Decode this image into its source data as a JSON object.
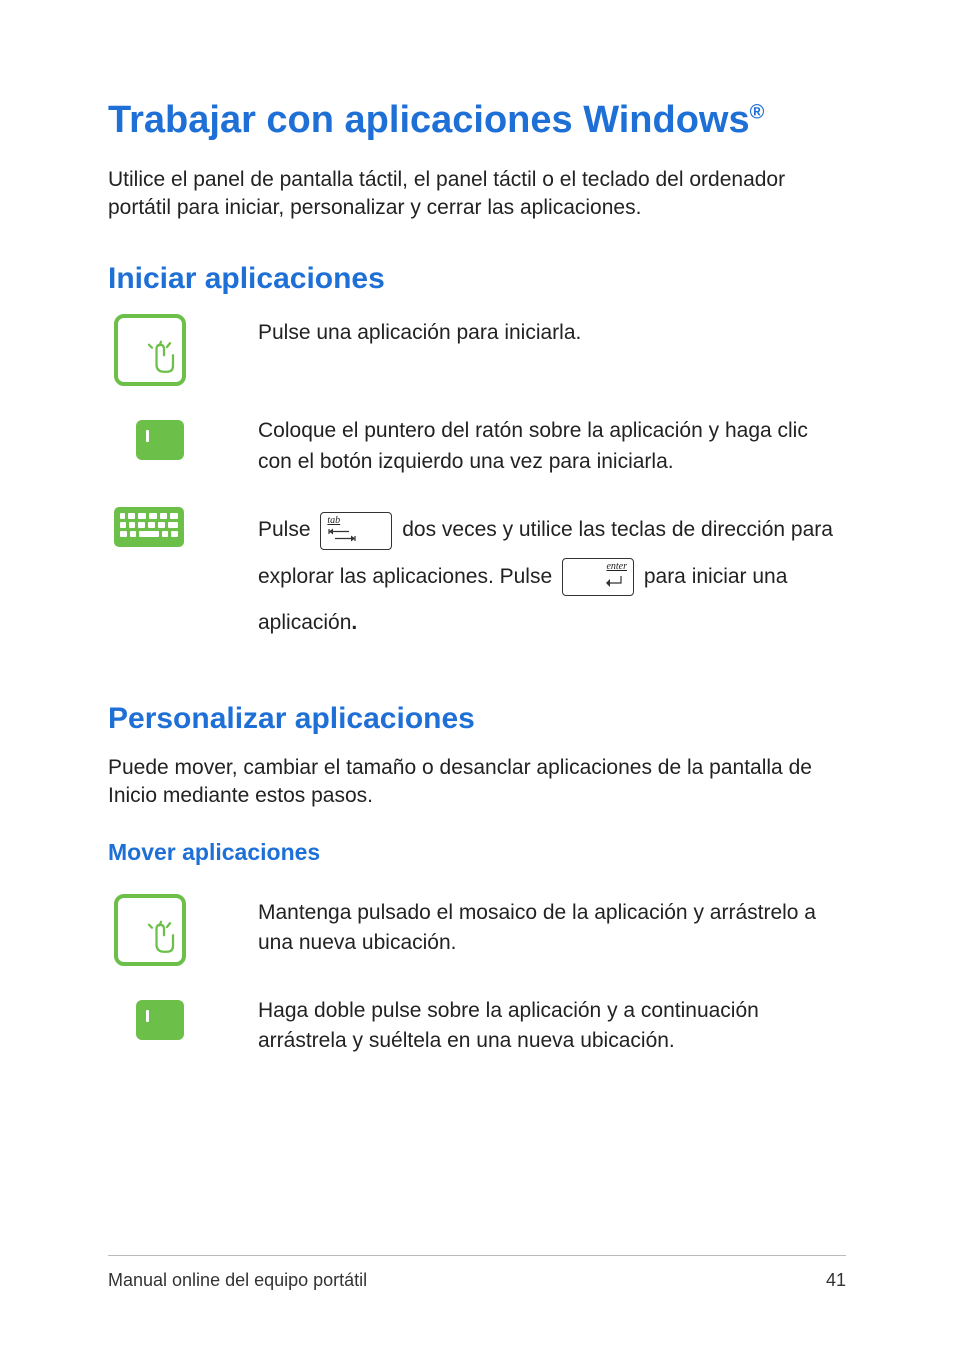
{
  "h1": {
    "text": "Trabajar con aplicaciones Windows",
    "reg": "®"
  },
  "intro": "Utilice el panel de pantalla táctil, el panel táctil o el teclado del ordenador portátil para iniciar, personalizar y cerrar las aplicaciones.",
  "h2a": "Iniciar aplicaciones",
  "launch": {
    "touch": "Pulse una aplicación para iniciarla.",
    "pad": "Coloque el puntero del ratón sobre la aplicación y haga clic con el botón izquierdo una vez para iniciarla.",
    "kbd_pre": "Pulse ",
    "kbd_tab_label": "tab",
    "kbd_mid": " dos veces y utilice las teclas de dirección para explorar las aplicaciones. Pulse ",
    "kbd_enter_label": "enter",
    "kbd_post": " para iniciar una aplicación",
    "kbd_period": "."
  },
  "h2b": "Personalizar aplicaciones",
  "custom_intro": "Puede mover, cambiar el tamaño o desanclar aplicaciones de la pantalla de Inicio mediante estos pasos.",
  "h3a": "Mover aplicaciones",
  "move": {
    "touch": "Mantenga pulsado el mosaico de la aplicación y arrástrelo a una nueva ubicación.",
    "pad": "Haga doble pulse sobre la aplicación y a continuación arrástrela y suéltela en una nueva ubicación."
  },
  "footer": {
    "title": "Manual online del equipo portátil",
    "page": "41"
  }
}
